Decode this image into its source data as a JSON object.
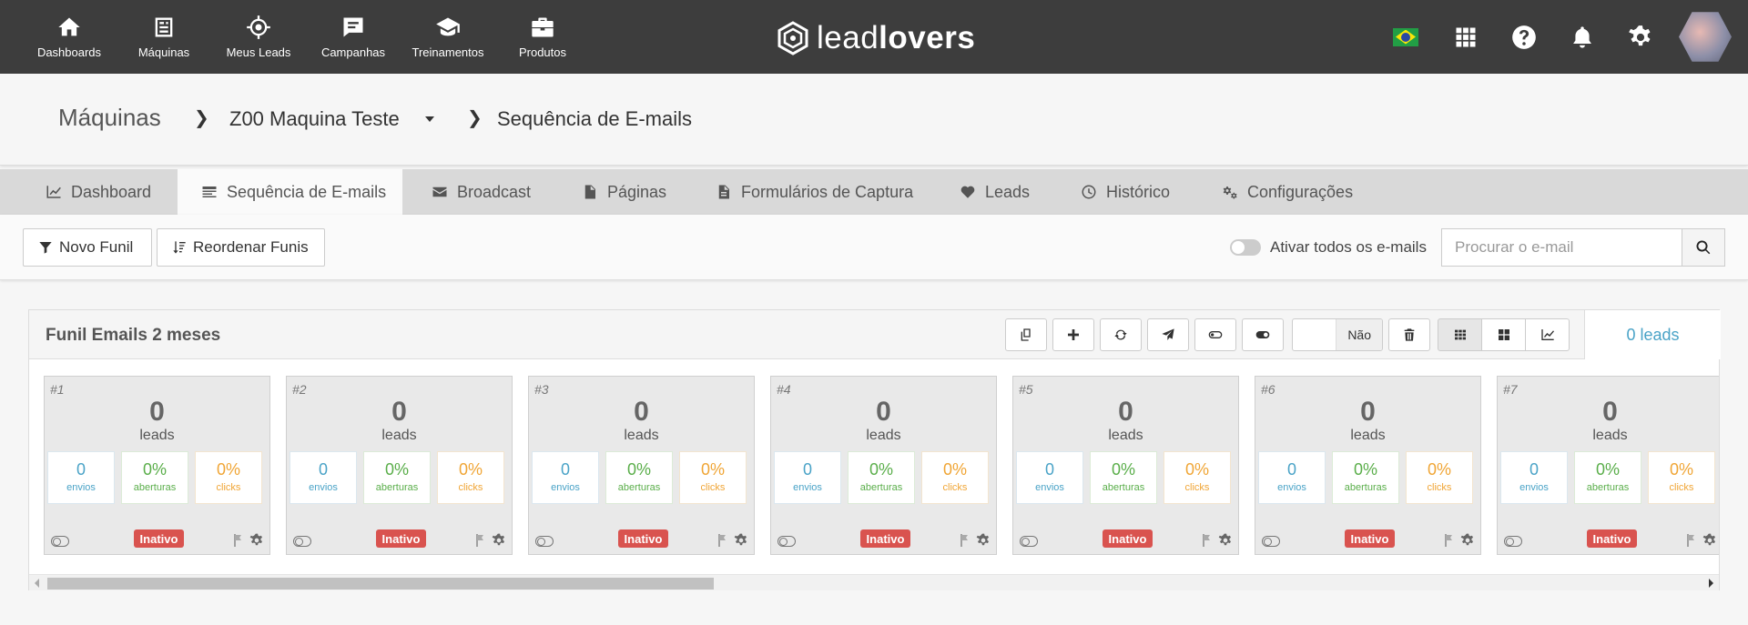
{
  "nav": {
    "items": [
      {
        "label": "Dashboards",
        "icon": "home-icon"
      },
      {
        "label": "Máquinas",
        "icon": "machine-icon"
      },
      {
        "label": "Meus Leads",
        "icon": "target-icon"
      },
      {
        "label": "Campanhas",
        "icon": "chat-icon"
      },
      {
        "label": "Treinamentos",
        "icon": "graduation-cap-icon"
      },
      {
        "label": "Produtos",
        "icon": "briefcase-icon"
      }
    ],
    "logo": {
      "part1": "lead",
      "part2": "lovers"
    },
    "right_icons": [
      "brazil-flag-icon",
      "apps-grid-icon",
      "help-icon",
      "bell-icon",
      "gear-icon"
    ]
  },
  "breadcrumb": {
    "root": "Máquinas",
    "machine": "Z00 Maquina Teste",
    "current": "Sequência de E-mails"
  },
  "tabs": [
    {
      "label": "Dashboard",
      "icon": "chart-line-icon"
    },
    {
      "label": "Sequência de E-mails",
      "icon": "list-icon",
      "active": true
    },
    {
      "label": "Broadcast",
      "icon": "envelope-icon"
    },
    {
      "label": "Páginas",
      "icon": "file-icon"
    },
    {
      "label": "Formulários de Captura",
      "icon": "file-text-icon"
    },
    {
      "label": "Leads",
      "icon": "heart-icon"
    },
    {
      "label": "Histórico",
      "icon": "clock-icon"
    },
    {
      "label": "Configurações",
      "icon": "cogs-icon"
    }
  ],
  "toolbar": {
    "novo_funil": "Novo Funil",
    "reordenar_funis": "Reordenar Funis",
    "ativar_todos": "Ativar todos os e-mails",
    "search_placeholder": "Procurar o e-mail"
  },
  "funnel": {
    "title": "Funil Emails 2 meses",
    "nao_label": "Não",
    "leads_total": "0 leads",
    "cards": [
      {
        "num": "#1",
        "leads": "0",
        "leads_label": "leads",
        "envios": "0",
        "envios_label": "envios",
        "aberturas": "0%",
        "aberturas_label": "aberturas",
        "clicks": "0%",
        "clicks_label": "clicks",
        "status": "Inativo"
      },
      {
        "num": "#2",
        "leads": "0",
        "leads_label": "leads",
        "envios": "0",
        "envios_label": "envios",
        "aberturas": "0%",
        "aberturas_label": "aberturas",
        "clicks": "0%",
        "clicks_label": "clicks",
        "status": "Inativo"
      },
      {
        "num": "#3",
        "leads": "0",
        "leads_label": "leads",
        "envios": "0",
        "envios_label": "envios",
        "aberturas": "0%",
        "aberturas_label": "aberturas",
        "clicks": "0%",
        "clicks_label": "clicks",
        "status": "Inativo"
      },
      {
        "num": "#4",
        "leads": "0",
        "leads_label": "leads",
        "envios": "0",
        "envios_label": "envios",
        "aberturas": "0%",
        "aberturas_label": "aberturas",
        "clicks": "0%",
        "clicks_label": "clicks",
        "status": "Inativo"
      },
      {
        "num": "#5",
        "leads": "0",
        "leads_label": "leads",
        "envios": "0",
        "envios_label": "envios",
        "aberturas": "0%",
        "aberturas_label": "aberturas",
        "clicks": "0%",
        "clicks_label": "clicks",
        "status": "Inativo"
      },
      {
        "num": "#6",
        "leads": "0",
        "leads_label": "leads",
        "envios": "0",
        "envios_label": "envios",
        "aberturas": "0%",
        "aberturas_label": "aberturas",
        "clicks": "0%",
        "clicks_label": "clicks",
        "status": "Inativo"
      },
      {
        "num": "#7",
        "leads": "0",
        "leads_label": "leads",
        "envios": "0",
        "envios_label": "envios",
        "aberturas": "0%",
        "aberturas_label": "aberturas",
        "clicks": "0%",
        "clicks_label": "clicks",
        "status": "Inativo"
      }
    ]
  },
  "colors": {
    "topbar": "#3d3d3d",
    "accent_blue": "#4aa3c7",
    "accent_green": "#5aae4a",
    "accent_orange": "#f0a535",
    "inactive_red": "#d9534f"
  }
}
